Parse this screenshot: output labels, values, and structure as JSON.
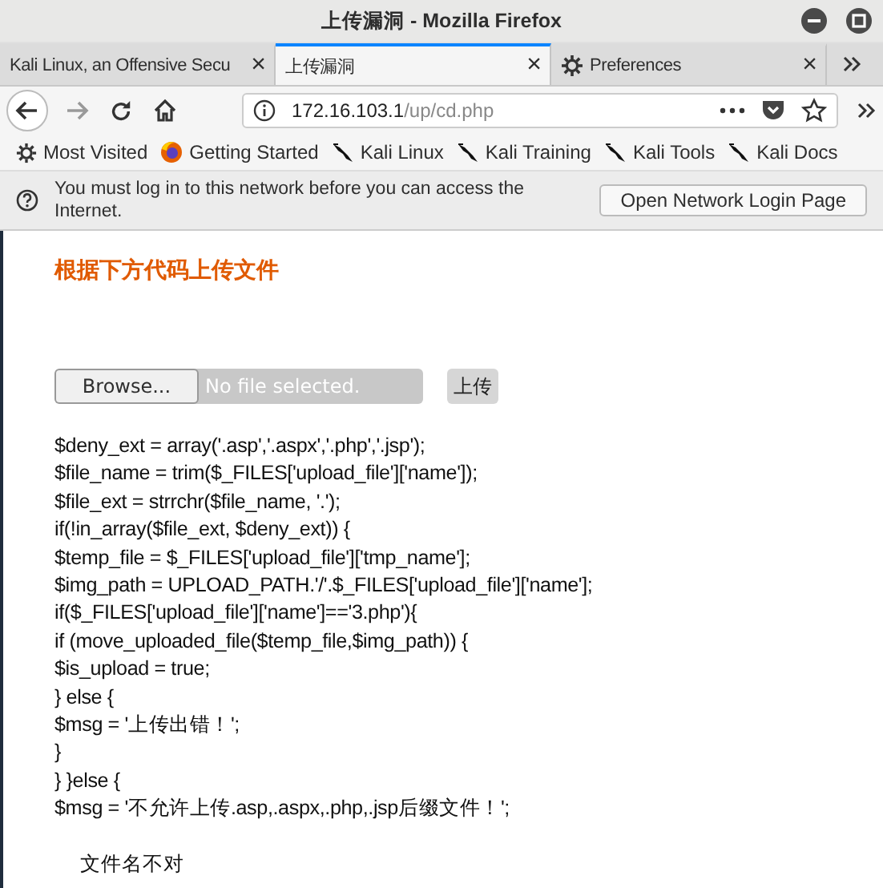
{
  "window": {
    "title": "上传漏洞 - Mozilla Firefox"
  },
  "tabs": [
    {
      "label": "Kali Linux, an Offensive Secu",
      "selected": false,
      "close": "×"
    },
    {
      "label": "上传漏洞",
      "selected": true,
      "close": "×"
    },
    {
      "label": "Preferences",
      "selected": false,
      "close": "×",
      "kind": "gear"
    }
  ],
  "url": {
    "host": "172.16.103.1",
    "path": "/up/cd.php"
  },
  "bookmarks": [
    {
      "label": "Most Visited",
      "kind": "gear"
    },
    {
      "label": "Getting Started",
      "kind": "globe"
    },
    {
      "label": "Kali Linux",
      "kind": "dragon"
    },
    {
      "label": "Kali Training",
      "kind": "dragon"
    },
    {
      "label": "Kali Tools",
      "kind": "dragon"
    },
    {
      "label": "Kali Docs",
      "kind": "dragon"
    }
  ],
  "notification": {
    "message": "You must log in to this network before you can access the Internet.",
    "button": "Open Network Login Page"
  },
  "page": {
    "heading": "根据下方代码上传文件",
    "file_input": {
      "button": "Browse...",
      "placeholder": "No file selected."
    },
    "upload_button": "上传",
    "code": [
      "$deny_ext = array('.asp','.aspx','.php','.jsp');",
      "$file_name = trim($_FILES['upload_file']['name']);",
      "$file_ext = strrchr($file_name, '.');",
      "if(!in_array($file_ext, $deny_ext)) {",
      "$temp_file = $_FILES['upload_file']['tmp_name'];",
      "$img_path = UPLOAD_PATH.'/'.$_FILES['upload_file']['name'];",
      "if($_FILES['upload_file']['name']=='3.php'){",
      "if (move_uploaded_file($temp_file,$img_path)) {",
      "$is_upload = true;",
      "} else {",
      "$msg = '上传出错！';",
      "}",
      "} }else {",
      "$msg = '不允许上传.asp,.aspx,.php,.jsp后缀文件！';"
    ],
    "result": "文件名不对"
  }
}
